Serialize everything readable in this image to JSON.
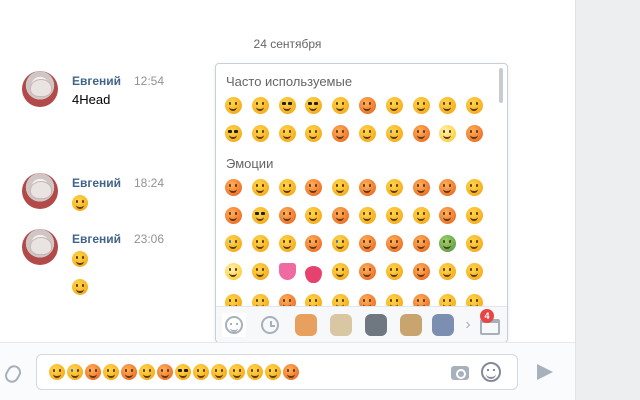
{
  "date_separator": "24 сентября",
  "messages": [
    {
      "author": "Евгений",
      "time": "12:54",
      "text": "4Head"
    },
    {
      "author": "Евгений",
      "time": "18:24",
      "text": ""
    },
    {
      "author": "Евгений",
      "time": "23:06",
      "text": ""
    }
  ],
  "emoji_panel": {
    "sections": [
      {
        "title": "Часто используемые"
      },
      {
        "title": "Эмоции"
      }
    ],
    "badge_count": "4"
  },
  "composer": {
    "icons": [
      "paperclip-icon",
      "camera-icon",
      "smile-icon",
      "send-icon"
    ]
  }
}
